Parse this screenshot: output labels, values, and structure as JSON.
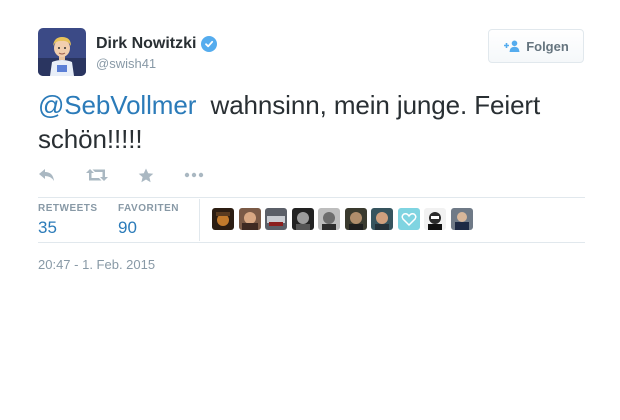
{
  "user": {
    "display_name": "Dirk Nowitzki",
    "handle": "@swish41",
    "verified": true
  },
  "follow_button": {
    "label": "Folgen",
    "icon": "follow-person-plus-icon"
  },
  "tweet": {
    "mention": "@SebVollmer",
    "text": "  wahnsinn, mein junge. Feiert schön!!!!!"
  },
  "actions": [
    "reply-icon",
    "retweet-icon",
    "favorite-star-icon",
    "more-dots-icon"
  ],
  "stats": {
    "retweets_label": "RETWEETS",
    "retweets_value": "35",
    "favorites_label": "FAVORITEN",
    "favorites_value": "90"
  },
  "favoriters_count_shown": 10,
  "timestamp": "20:47 - 1. Feb. 2015",
  "colors": {
    "link": "#2b7bb9",
    "muted": "#8899a6",
    "text": "#292f33",
    "verified": "#55acee",
    "border": "#e1e8ed"
  }
}
